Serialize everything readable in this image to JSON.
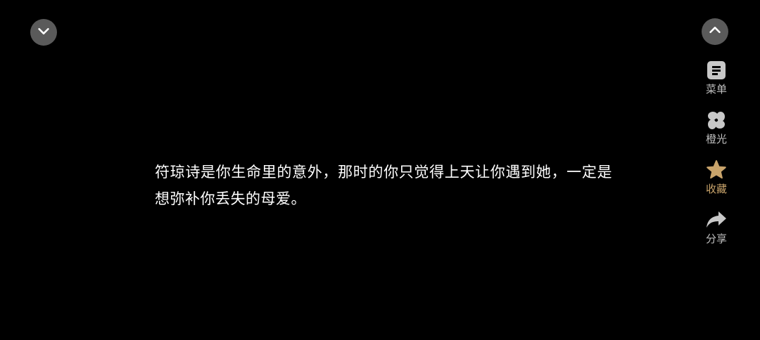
{
  "controls": {
    "collapse_icon": "chevron-down-icon",
    "expand_icon": "chevron-up-icon"
  },
  "side_menu": {
    "items": [
      {
        "id": "menu",
        "label": "菜单",
        "icon": "menu-icon"
      },
      {
        "id": "lighting",
        "label": "橙光",
        "icon": "orange-light-logo-icon"
      },
      {
        "id": "favorite",
        "label": "收藏",
        "icon": "star-icon"
      },
      {
        "id": "share",
        "label": "分享",
        "icon": "share-arrow-icon"
      }
    ]
  },
  "story": {
    "text": "符琼诗是你生命里的意外，那时的你只觉得上天让你遇到她，一定是想弥补你丢失的母爱。"
  },
  "colors": {
    "background": "#000000",
    "button_bg": "#5a5a5a",
    "icon_gray": "#c8c8c8",
    "favorite_gold": "#c9a46b"
  }
}
